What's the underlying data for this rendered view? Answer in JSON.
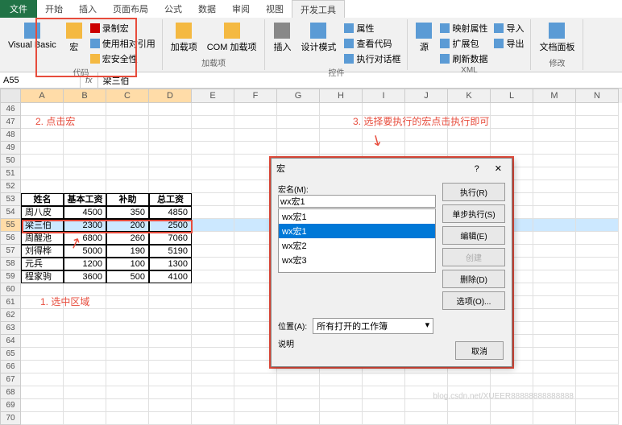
{
  "tabs": {
    "file": "文件",
    "list": [
      "开始",
      "插入",
      "页面布局",
      "公式",
      "数据",
      "审阅",
      "视图",
      "开发工具"
    ],
    "active": 7
  },
  "ribbon": {
    "g1": {
      "label": "代码",
      "vb": "Visual Basic",
      "macro": "宏",
      "rec": "录制宏",
      "useRel": "使用相对引用",
      "sec": "宏安全性"
    },
    "g2": {
      "label": "加载项",
      "add": "加载项",
      "com": "COM 加载项"
    },
    "g3": {
      "label": "控件",
      "insert": "插入",
      "design": "设计模式",
      "prop": "属性",
      "view": "查看代码",
      "run": "执行对话框"
    },
    "g4": {
      "label": "XML",
      "src": "源",
      "map": "映射属性",
      "ext": "扩展包",
      "refresh": "刷新数据",
      "imp": "导入",
      "exp": "导出"
    },
    "g5": {
      "label": "修改",
      "panel": "文档面板"
    }
  },
  "formula": {
    "cell": "A55",
    "value": "梁三伯"
  },
  "cols": [
    "A",
    "B",
    "C",
    "D",
    "E",
    "F",
    "G",
    "H",
    "I",
    "J",
    "K",
    "L",
    "M",
    "N"
  ],
  "rowStart": 46,
  "rowEnd": 70,
  "table": {
    "headers": [
      "姓名",
      "基本工资",
      "补助",
      "总工资"
    ],
    "rows": [
      [
        "周八皮",
        "4500",
        "350",
        "4850"
      ],
      [
        "梁三伯",
        "2300",
        "200",
        "2500"
      ],
      [
        "周醒池",
        "6800",
        "260",
        "7060"
      ],
      [
        "刘得桦",
        "5000",
        "190",
        "5190"
      ],
      [
        "元兵",
        "1200",
        "100",
        "1300"
      ],
      [
        "程家驹",
        "3600",
        "500",
        "4100"
      ]
    ],
    "selectedRow": 1,
    "startRow": 53
  },
  "anno": {
    "a1": "1. 选中区域",
    "a2": "2. 点击宏",
    "a3": "3. 选择要执行的宏点击执行即可"
  },
  "dialog": {
    "title": "宏",
    "nameLabel": "宏名(M):",
    "nameVal": "wx宏1",
    "items": [
      "wx宏1",
      "wx宏1",
      "wx宏2",
      "wx宏3"
    ],
    "selIdx": 1,
    "btns": {
      "run": "执行(R)",
      "step": "单步执行(S)",
      "edit": "编辑(E)",
      "create": "创建",
      "delete": "删除(D)",
      "opts": "选项(O)..."
    },
    "locLabel": "位置(A):",
    "locVal": "所有打开的工作簿",
    "descLabel": "说明",
    "cancel": "取消",
    "help": "?"
  },
  "watermark": "blog.csdn.net/XUEER88888888888888"
}
